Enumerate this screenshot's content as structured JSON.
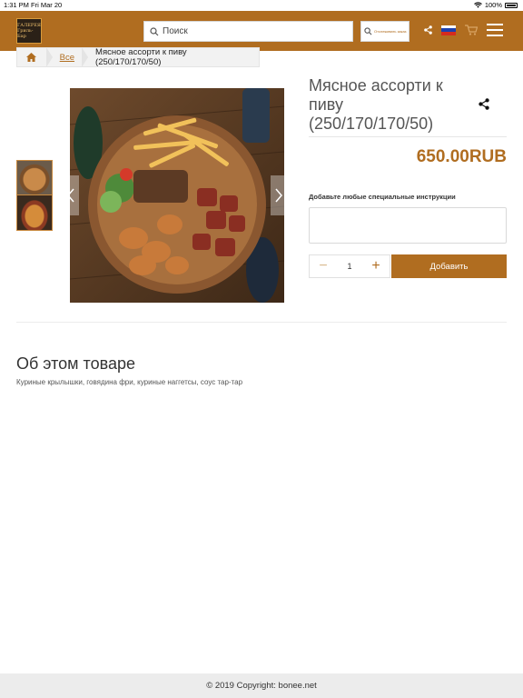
{
  "status_bar": {
    "time": "1:31 PM",
    "date": "Fri Mar 20",
    "battery": "100%"
  },
  "header": {
    "logo_line1": "ГАЛЕРЕЯ",
    "logo_line2": "Гриль-Бар",
    "search_placeholder": "Поиск",
    "track_order_label": "Отслеживать заказ",
    "language": "RU",
    "colors": {
      "brand": "#b06d20"
    }
  },
  "breadcrumb": {
    "all_label": "Все",
    "current": "Мясное ассорти к пиву (250/170/170/50)"
  },
  "product": {
    "title": "Мясное ассорти к пиву (250/170/170/50)",
    "price": "650.00RUB",
    "instructions_label": "Добавьте любые специальные инструкции",
    "quantity": "1",
    "minus_label": "−",
    "plus_label": "+",
    "add_label": "Добавить"
  },
  "about": {
    "title": "Об этом товаре",
    "description": "Куриные крылышки, говядина фри, куриные наггетсы, соус тар-тар"
  },
  "footer": {
    "copyright": "© 2019 Copyright: bonee.net"
  }
}
